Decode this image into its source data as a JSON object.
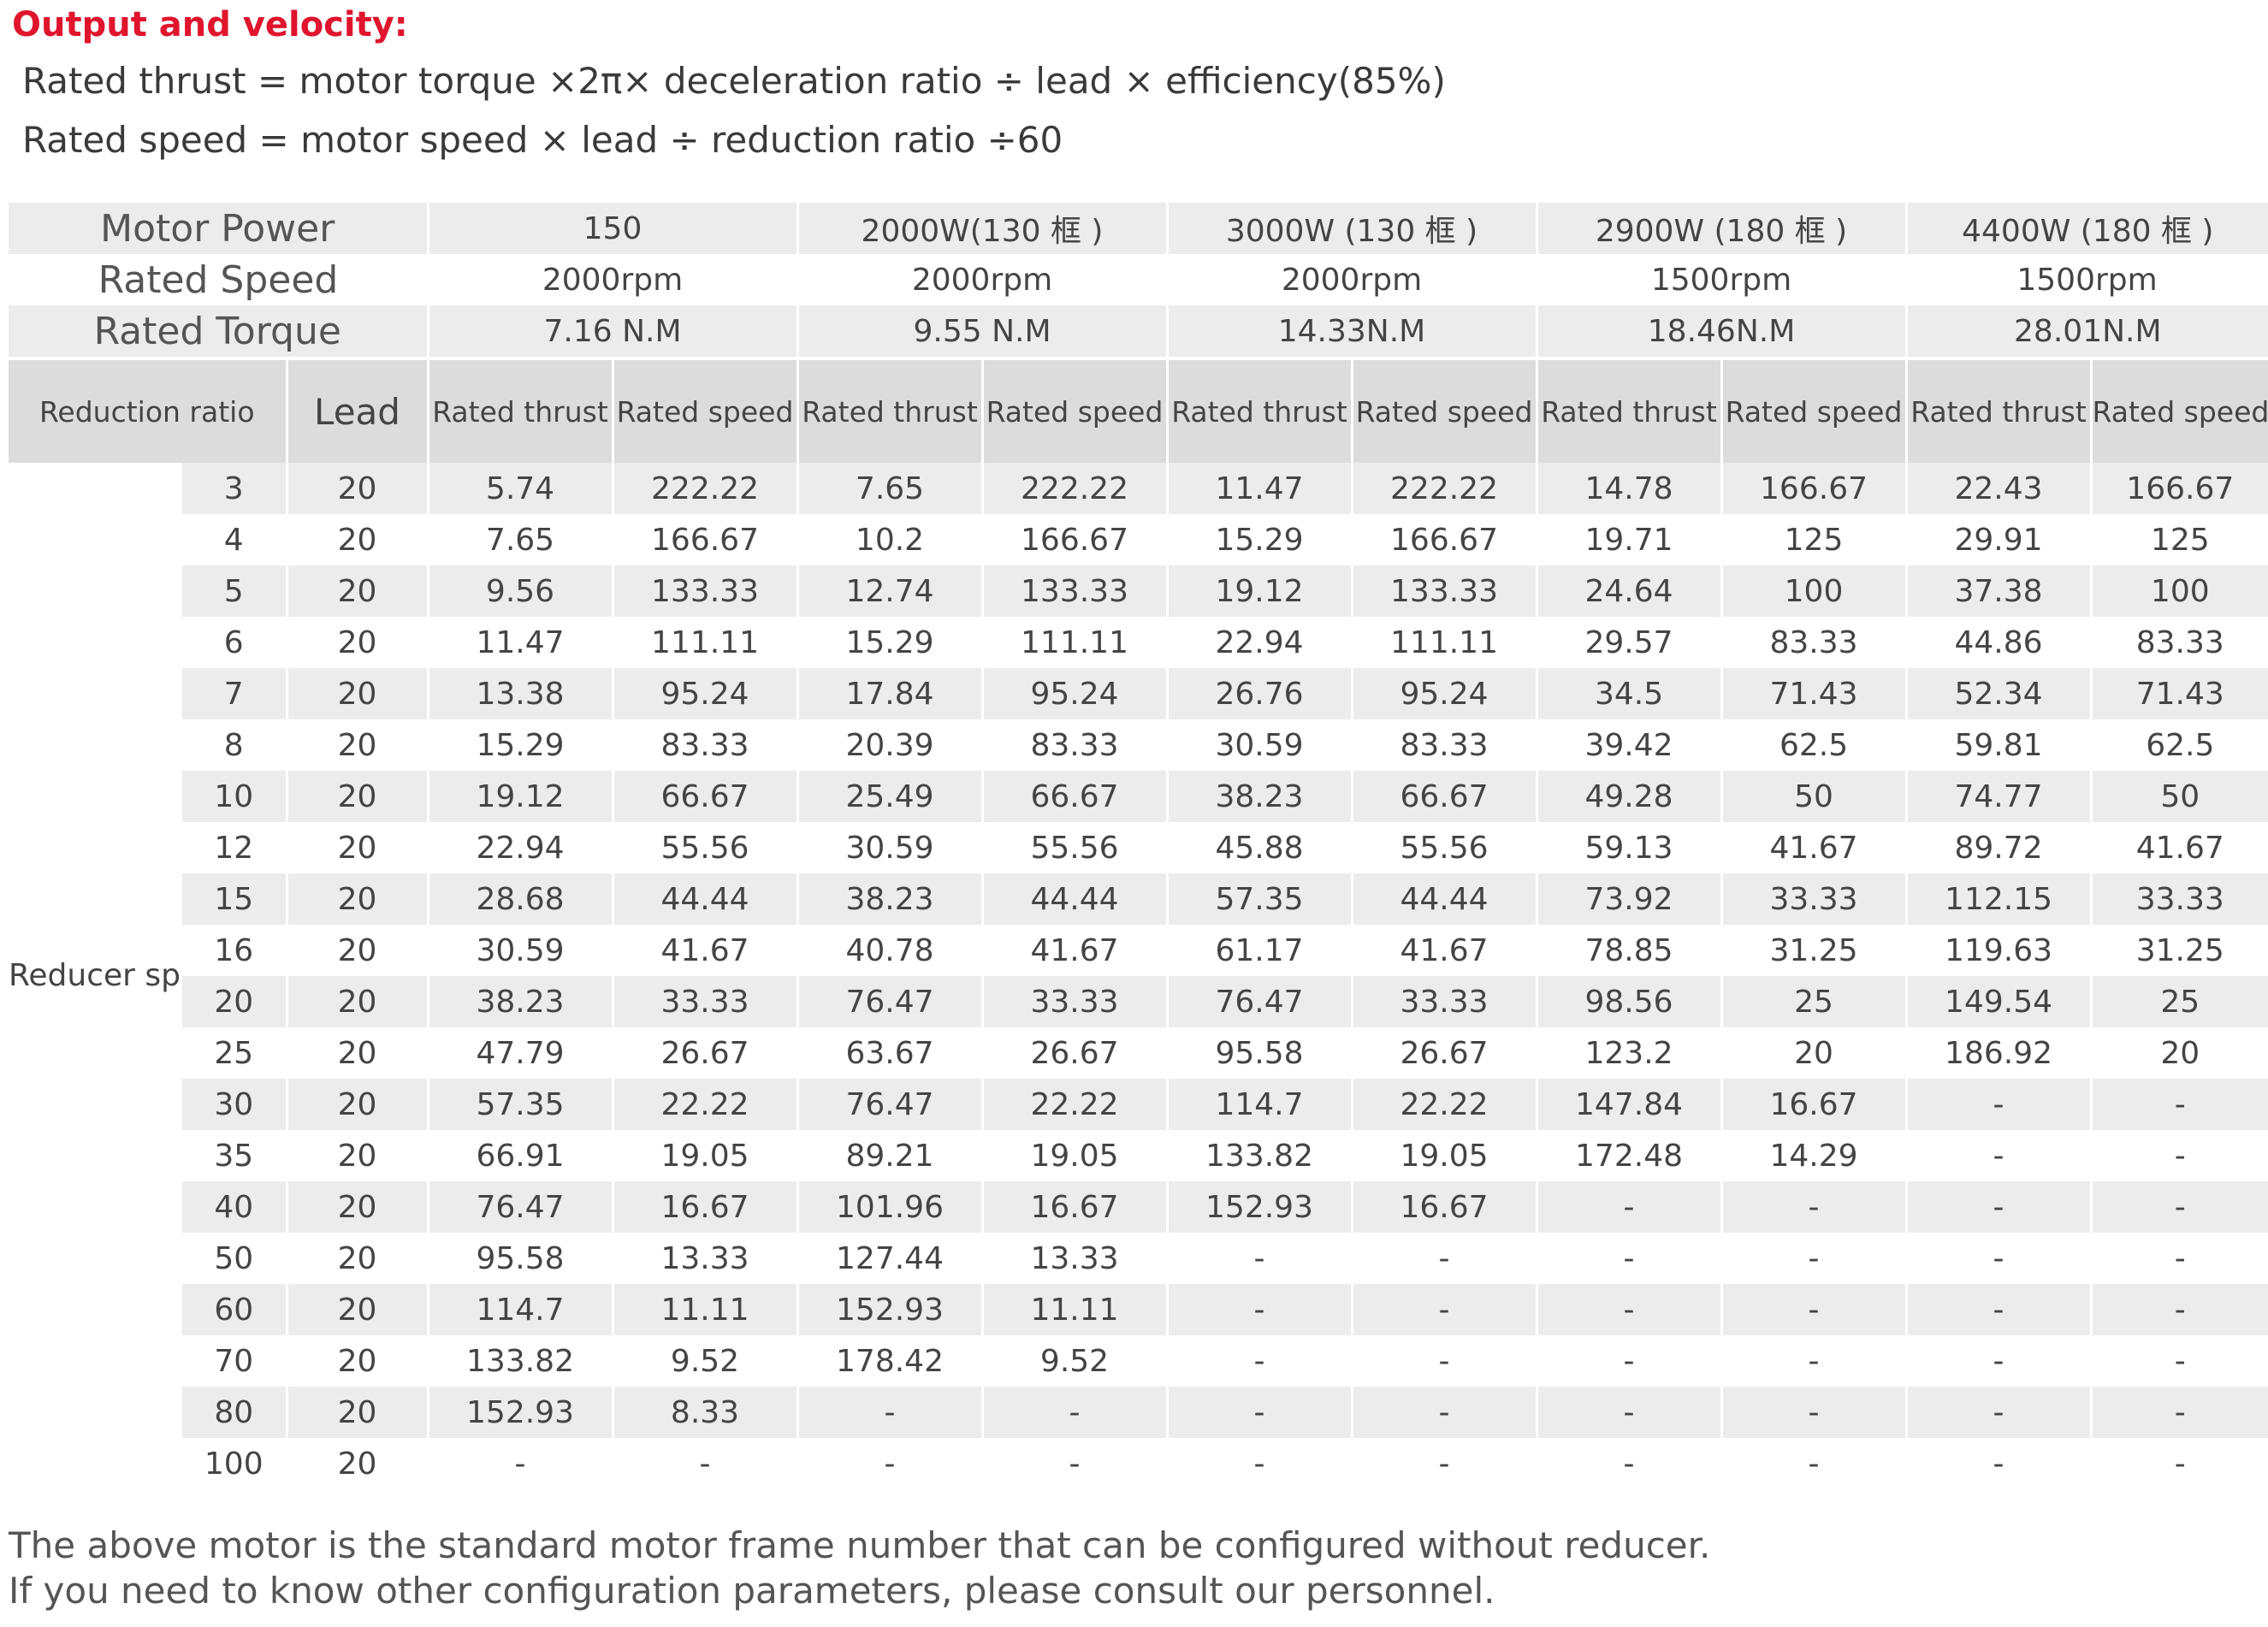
{
  "title": "Output and velocity:",
  "formulas": [
    "Rated thrust = motor torque ×2π× deceleration ratio ÷ lead × efficiency(85%)",
    "Rated speed = motor speed × lead ÷ reduction ratio ÷60"
  ],
  "header": {
    "motor_power_label": "Motor Power",
    "rated_speed_label": "Rated Speed",
    "rated_torque_label": "Rated Torque",
    "motors": [
      {
        "power": "150",
        "speed": "2000rpm",
        "torque": "7.16 N.M"
      },
      {
        "power": "2000W(130 框 )",
        "speed": "2000rpm",
        "torque": "9.55 N.M"
      },
      {
        "power": "3000W (130 框 )",
        "speed": "2000rpm",
        "torque": "14.33N.M"
      },
      {
        "power": "2900W (180 框 )",
        "speed": "1500rpm",
        "torque": "18.46N.M"
      },
      {
        "power": "4400W (180 框 )",
        "speed": "1500rpm",
        "torque": "28.01N.M"
      }
    ]
  },
  "columns": {
    "reduction_ratio": "Reduction ratio",
    "lead": "Lead",
    "rated_thrust": "Rated thrust",
    "rated_speed": "Rated speed"
  },
  "row_group_label": "Reducer speed ratio",
  "rows": [
    {
      "ratio": "3",
      "lead": "20",
      "values": [
        "5.74",
        "222.22",
        "7.65",
        "222.22",
        "11.47",
        "222.22",
        "14.78",
        "166.67",
        "22.43",
        "166.67"
      ]
    },
    {
      "ratio": "4",
      "lead": "20",
      "values": [
        "7.65",
        "166.67",
        "10.2",
        "166.67",
        "15.29",
        "166.67",
        "19.71",
        "125",
        "29.91",
        "125"
      ]
    },
    {
      "ratio": "5",
      "lead": "20",
      "values": [
        "9.56",
        "133.33",
        "12.74",
        "133.33",
        "19.12",
        "133.33",
        "24.64",
        "100",
        "37.38",
        "100"
      ]
    },
    {
      "ratio": "6",
      "lead": "20",
      "values": [
        "11.47",
        "111.11",
        "15.29",
        "111.11",
        "22.94",
        "111.11",
        "29.57",
        "83.33",
        "44.86",
        "83.33"
      ]
    },
    {
      "ratio": "7",
      "lead": "20",
      "values": [
        "13.38",
        "95.24",
        "17.84",
        "95.24",
        "26.76",
        "95.24",
        "34.5",
        "71.43",
        "52.34",
        "71.43"
      ]
    },
    {
      "ratio": "8",
      "lead": "20",
      "values": [
        "15.29",
        "83.33",
        "20.39",
        "83.33",
        "30.59",
        "83.33",
        "39.42",
        "62.5",
        "59.81",
        "62.5"
      ]
    },
    {
      "ratio": "10",
      "lead": "20",
      "values": [
        "19.12",
        "66.67",
        "25.49",
        "66.67",
        "38.23",
        "66.67",
        "49.28",
        "50",
        "74.77",
        "50"
      ]
    },
    {
      "ratio": "12",
      "lead": "20",
      "values": [
        "22.94",
        "55.56",
        "30.59",
        "55.56",
        "45.88",
        "55.56",
        "59.13",
        "41.67",
        "89.72",
        "41.67"
      ]
    },
    {
      "ratio": "15",
      "lead": "20",
      "values": [
        "28.68",
        "44.44",
        "38.23",
        "44.44",
        "57.35",
        "44.44",
        "73.92",
        "33.33",
        "112.15",
        "33.33"
      ]
    },
    {
      "ratio": "16",
      "lead": "20",
      "values": [
        "30.59",
        "41.67",
        "40.78",
        "41.67",
        "61.17",
        "41.67",
        "78.85",
        "31.25",
        "119.63",
        "31.25"
      ]
    },
    {
      "ratio": "20",
      "lead": "20",
      "values": [
        "38.23",
        "33.33",
        "76.47",
        "33.33",
        "76.47",
        "33.33",
        "98.56",
        "25",
        "149.54",
        "25"
      ]
    },
    {
      "ratio": "25",
      "lead": "20",
      "values": [
        "47.79",
        "26.67",
        "63.67",
        "26.67",
        "95.58",
        "26.67",
        "123.2",
        "20",
        "186.92",
        "20"
      ]
    },
    {
      "ratio": "30",
      "lead": "20",
      "values": [
        "57.35",
        "22.22",
        "76.47",
        "22.22",
        "114.7",
        "22.22",
        "147.84",
        "16.67",
        "-",
        "-"
      ]
    },
    {
      "ratio": "35",
      "lead": "20",
      "values": [
        "66.91",
        "19.05",
        "89.21",
        "19.05",
        "133.82",
        "19.05",
        "172.48",
        "14.29",
        "-",
        "-"
      ]
    },
    {
      "ratio": "40",
      "lead": "20",
      "values": [
        "76.47",
        "16.67",
        "101.96",
        "16.67",
        "152.93",
        "16.67",
        "-",
        "-",
        "-",
        "-"
      ]
    },
    {
      "ratio": "50",
      "lead": "20",
      "values": [
        "95.58",
        "13.33",
        "127.44",
        "13.33",
        "-",
        "-",
        "-",
        "-",
        "-",
        "-"
      ]
    },
    {
      "ratio": "60",
      "lead": "20",
      "values": [
        "114.7",
        "11.11",
        "152.93",
        "11.11",
        "-",
        "-",
        "-",
        "-",
        "-",
        "-"
      ]
    },
    {
      "ratio": "70",
      "lead": "20",
      "values": [
        "133.82",
        "9.52",
        "178.42",
        "9.52",
        "-",
        "-",
        "-",
        "-",
        "-",
        "-"
      ]
    },
    {
      "ratio": "80",
      "lead": "20",
      "values": [
        "152.93",
        "8.33",
        "-",
        "-",
        "-",
        "-",
        "-",
        "-",
        "-",
        "-"
      ]
    },
    {
      "ratio": "100",
      "lead": "20",
      "values": [
        "-",
        "-",
        "-",
        "-",
        "-",
        "-",
        "-",
        "-",
        "-",
        "-"
      ]
    }
  ],
  "notes": [
    "The above motor is the standard motor frame number that can be configured without reducer.",
    "If you need to know other configuration parameters, please consult our personnel."
  ]
}
